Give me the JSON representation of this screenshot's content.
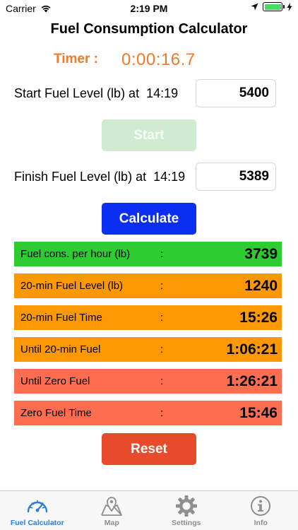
{
  "status_bar": {
    "carrier": "Carrier",
    "time": "2:19 PM"
  },
  "title": "Fuel Consumption Calculator",
  "timer": {
    "label": "Timer :",
    "value": "0:00:16.7"
  },
  "start": {
    "label": "Start Fuel Level (lb) at",
    "time": "14:19",
    "value": "5400"
  },
  "finish": {
    "label": "Finish Fuel Level (lb) at",
    "time": "14:19",
    "value": "5389"
  },
  "buttons": {
    "start": "Start",
    "calculate": "Calculate",
    "reset": "Reset"
  },
  "colors": {
    "accent_orange": "#f07a2a",
    "green": "#2ecc30",
    "orange": "#fc9804",
    "salmon": "#fd6e51",
    "blue": "#0a2ff2",
    "red": "#e84a2c"
  },
  "results": [
    {
      "label": "Fuel cons. per hour (lb)",
      "colon": ":",
      "value": "3739",
      "color": "#2ecc30"
    },
    {
      "label": "20-min Fuel Level (lb)",
      "colon": ":",
      "value": "1240",
      "color": "#fc9804"
    },
    {
      "label": "20-min Fuel Time",
      "colon": ":",
      "value": "15:26",
      "color": "#fc9804"
    },
    {
      "label": "Until 20-min Fuel",
      "colon": ":",
      "value": "1:06:21",
      "color": "#fc9804"
    },
    {
      "label": "Until Zero Fuel",
      "colon": ":",
      "value": "1:26:21",
      "color": "#fd6e51"
    },
    {
      "label": "Zero Fuel Time",
      "colon": ":",
      "value": "15:46",
      "color": "#fd6e51"
    }
  ],
  "tabs": [
    {
      "label": "Fuel Calculator",
      "icon": "gauge-icon",
      "active": true
    },
    {
      "label": "Map",
      "icon": "map-icon",
      "active": false
    },
    {
      "label": "Settings",
      "icon": "gear-icon",
      "active": false
    },
    {
      "label": "Info",
      "icon": "info-icon",
      "active": false
    }
  ]
}
